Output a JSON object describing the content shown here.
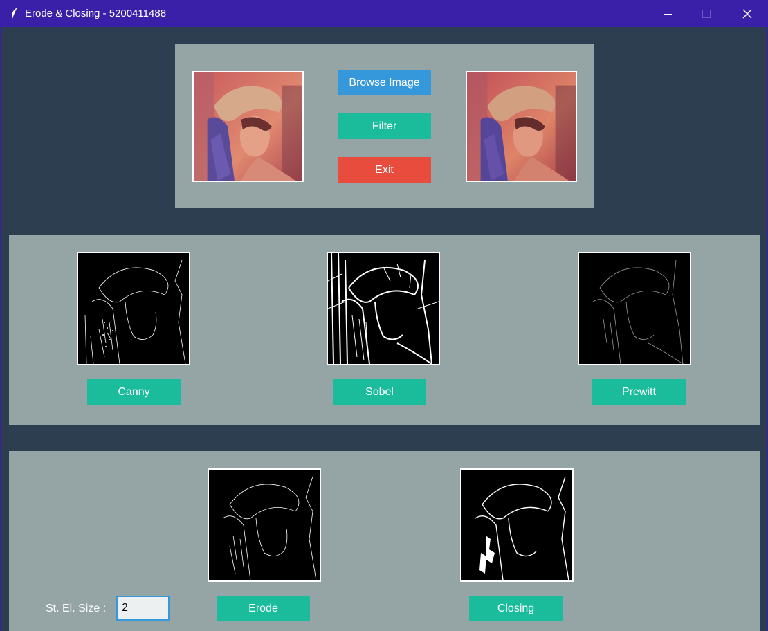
{
  "window": {
    "title": "Erode & Closing - 5200411488"
  },
  "top_panel": {
    "browse_label": "Browse Image",
    "filter_label": "Filter",
    "exit_label": "Exit"
  },
  "edge_panel": {
    "canny_label": "Canny",
    "sobel_label": "Sobel",
    "prewitt_label": "Prewitt"
  },
  "morph_panel": {
    "size_label": "St. El. Size :",
    "size_value": "2",
    "erode_label": "Erode",
    "closing_label": "Closing"
  },
  "colors": {
    "background": "#2c3e50",
    "panel": "#95a5a6",
    "titlebar": "#3a1fa8",
    "blue": "#3498db",
    "teal": "#1abc9c",
    "red": "#e74c3c"
  }
}
